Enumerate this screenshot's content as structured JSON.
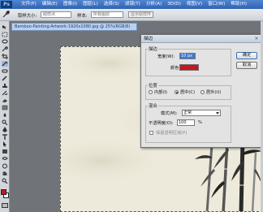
{
  "menubar": {
    "app_logo": "Ps",
    "items": [
      "文件(F)",
      "编辑(E)",
      "图像(I)",
      "图层(L)",
      "选择(S)",
      "滤镜(T)",
      "分析(A)",
      "3D(D)",
      "视图(V)",
      "窗口(W)",
      "帮助(H)"
    ]
  },
  "options_bar": {
    "tool_icon": "eyedropper-icon",
    "sample_size_label": "取样大小:",
    "sample_size_value": "取样点",
    "sample_label": "样本:",
    "sample_value": "所有图层",
    "extra_button": "显示取样环"
  },
  "document": {
    "tab_title": "Bamboo-Painting-Artwork-1920x1080.jpg @ 25%(RGB/8)"
  },
  "stroke_dialog": {
    "title": "描边",
    "stroke_group": {
      "title": "描边",
      "width_label": "宽度(W):",
      "width_value": "10 px",
      "color_label": "颜色:",
      "color_value": "#c8161e"
    },
    "location_group": {
      "title": "位置",
      "options": [
        "内部(I)",
        "居中(C)",
        "居外(U)"
      ],
      "selected_index": 1
    },
    "blending_group": {
      "title": "混合",
      "mode_label": "模式(M):",
      "mode_value": "正常",
      "opacity_label": "不透明度(O):",
      "opacity_value": "100",
      "opacity_unit": "%",
      "preserve_transparency_label": "保留透明区域(P)",
      "preserve_transparency_checked": false
    },
    "ok_label": "确定",
    "cancel_label": "取消"
  },
  "colors": {
    "foreground": "#c8161e",
    "background": "#ffffff",
    "canvas": "#eeeadb"
  }
}
